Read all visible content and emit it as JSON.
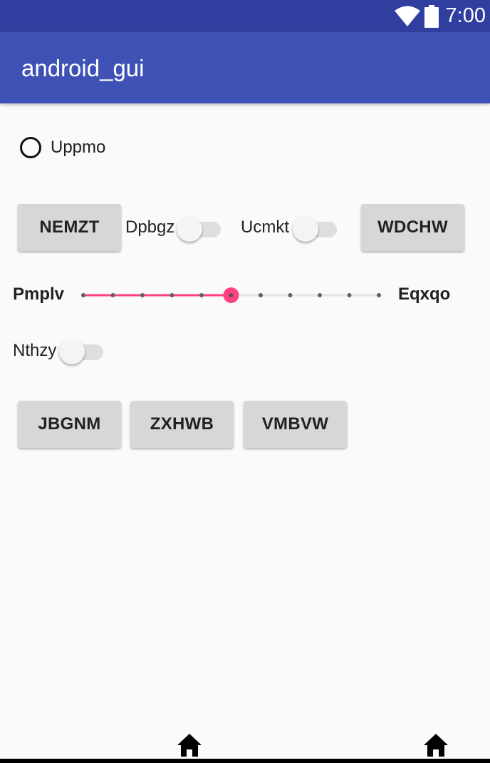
{
  "status_bar": {
    "time": "7:00",
    "icons": [
      "wifi-icon",
      "battery-icon"
    ]
  },
  "app_bar": {
    "title": "android_gui"
  },
  "radio": {
    "label": "Uppmo",
    "checked": false
  },
  "row1": {
    "button1": "NEMZT",
    "switch1": {
      "label": "Dpbgz",
      "on": false
    },
    "switch2": {
      "label": "Ucmkt",
      "on": false
    },
    "button2": "WDCHW"
  },
  "seekbar": {
    "start_label": "Pmplv",
    "end_label": "Eqxqo",
    "min": 0,
    "max": 10,
    "value": 5,
    "accent": "#ff4081"
  },
  "switch3": {
    "label": "Nthzy",
    "on": false
  },
  "row2": {
    "buttons": [
      "JBGNM",
      "ZXHWB",
      "VMBVW"
    ]
  },
  "nav_bar": {
    "icons": [
      "home-icon",
      "home-icon"
    ]
  },
  "colors": {
    "status_bar": "#303f9f",
    "app_bar": "#3f51b5",
    "background": "#fafafa",
    "button": "#d6d7d7"
  }
}
